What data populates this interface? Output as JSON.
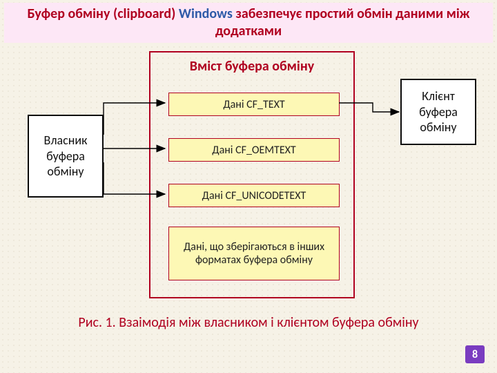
{
  "title": {
    "prefix": "Буфер обміну (clipboard) ",
    "accent": "Windows",
    "suffix": " забезпечує простий обмін даними між додатками"
  },
  "owner_label": "Власник буфера обміну",
  "client_label": "Клієнт буфера обміну",
  "center": {
    "title": "Вміст буфера обміну",
    "items": [
      "Дані CF_TEXT",
      "Дані CF_OEMTEXT",
      "Дані CF_UNICODETEXT",
      "Дані, що зберігаються в інших форматах буфера обміну"
    ]
  },
  "caption": "Рис. 1. Взаімодія між власником і клієнтом буфера обміну",
  "page_number": "8",
  "colors": {
    "accent_red": "#b00020",
    "accent_blue": "#2e5aa8",
    "badge_purple": "#7a3cc0",
    "data_box_fill": "#fdf8b5",
    "title_band": "#fde7f6"
  }
}
